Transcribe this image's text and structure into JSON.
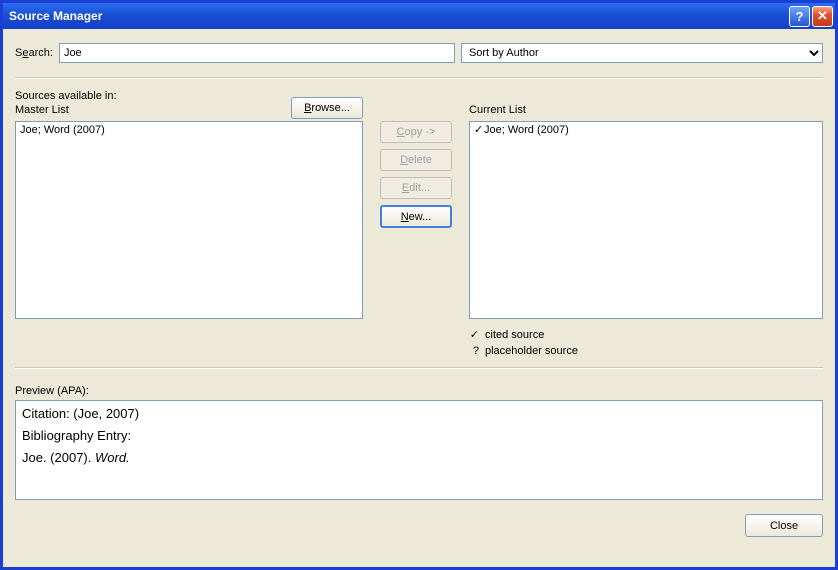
{
  "window": {
    "title": "Source Manager",
    "help_symbol": "?",
    "close_symbol": "✕"
  },
  "search": {
    "label_pre": "S",
    "label_u": "e",
    "label_post": "arch:",
    "value": "Joe"
  },
  "sort": {
    "selected": "Sort by Author"
  },
  "sources_available_label": "Sources available in:",
  "master_list": {
    "label": "Master List",
    "items": [
      "Joe; Word (2007)"
    ]
  },
  "browse": {
    "label_u": "B",
    "label_post": "rowse..."
  },
  "mid_buttons": {
    "copy": {
      "u": "C",
      "post": "opy ->",
      "disabled": true
    },
    "delete": {
      "u": "D",
      "post": "elete",
      "disabled": true
    },
    "edit": {
      "u": "E",
      "post": "dit...",
      "disabled": true
    },
    "new": {
      "u": "N",
      "post": "ew...",
      "disabled": false
    }
  },
  "current_list": {
    "label_pre": "C",
    "label_u": "u",
    "label_post": "rrent List",
    "items_check": "✓",
    "items": [
      "Joe; Word (2007)"
    ]
  },
  "legend": {
    "cited_symbol": "✓",
    "cited_label": "cited source",
    "placeholder_symbol": "?",
    "placeholder_label": "placeholder source"
  },
  "preview": {
    "label": "Preview (APA):",
    "citation_line": "Citation: (Joe, 2007)",
    "blank": " ",
    "bib_label": "Bibliography Entry:",
    "bib_entry_pre": "Joe. (2007). ",
    "bib_entry_italic": "Word.",
    "bib_entry_post": ""
  },
  "footer": {
    "close_label": "Close"
  }
}
